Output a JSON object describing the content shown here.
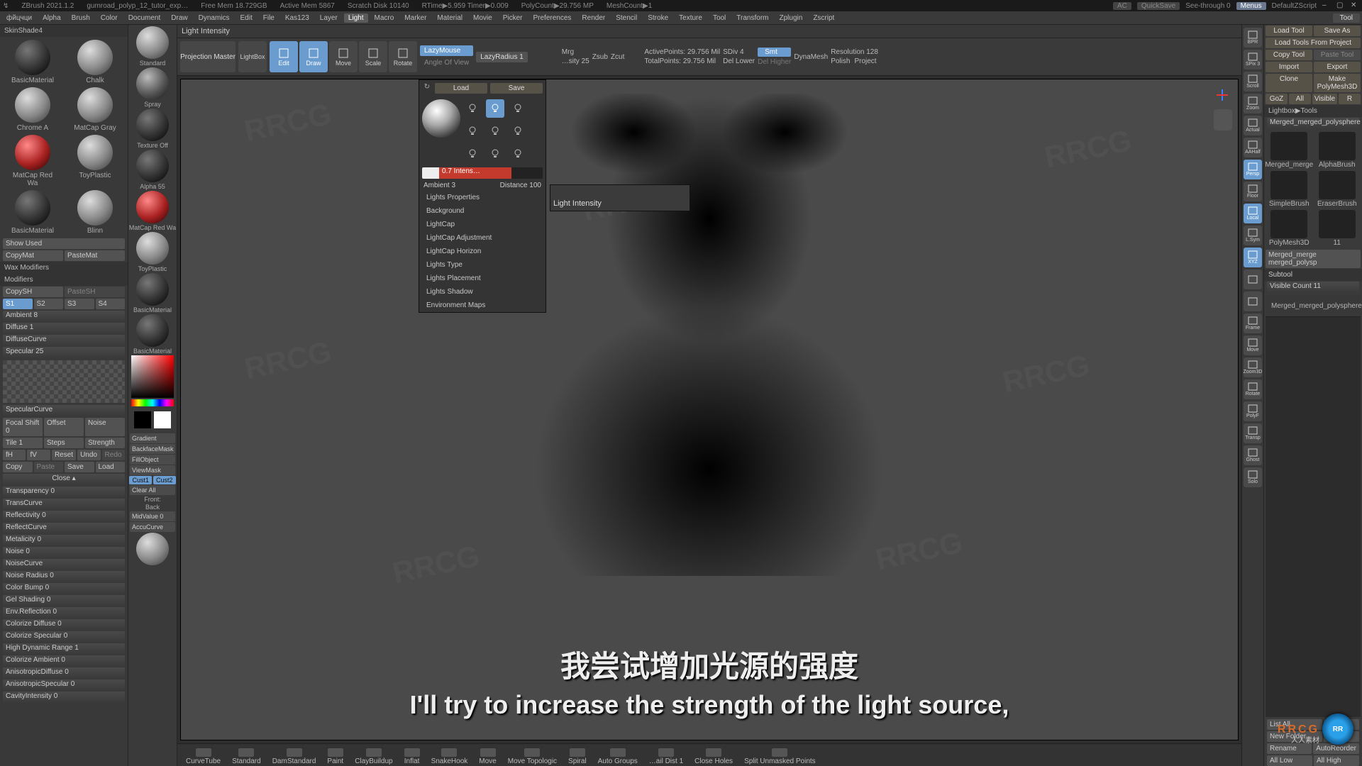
{
  "title": {
    "app": "ZBrush 2021.1.2",
    "doc": "gumroad_polyp_12_tutor_exp…",
    "mem": "Free Mem 18.729GB",
    "amem": "Active Mem 5867",
    "scratch": "Scratch Disk 10140",
    "rtime": "RTime▶5.959  Timer▶0.009",
    "polycount": "PolyCount▶29.756 MP",
    "meshcount": "MeshCount▶1",
    "ac": "AC",
    "quicksave": "QuickSave",
    "see": "See-through  0",
    "menus": "Menus",
    "zscript": "DefaultZScript"
  },
  "menu": {
    "items": [
      "фйцчци",
      "Alpha",
      "Brush",
      "Color",
      "Document",
      "Draw",
      "Dynamics",
      "Edit",
      "File",
      "Kas123",
      "Layer",
      "Light",
      "Macro",
      "Marker",
      "Material",
      "Movie",
      "Picker",
      "Preferences",
      "Render",
      "Stencil",
      "Stroke",
      "Texture",
      "Tool",
      "Transform",
      "Zplugin",
      "Zscript"
    ],
    "active": "Light",
    "tool": "Tool"
  },
  "status": "Light Intensity",
  "leftMaterials": {
    "shade_hdr": "SkinShade4",
    "cells": [
      {
        "name": "BasicMaterial",
        "style": "dark"
      },
      {
        "name": "Chalk",
        "style": "gray"
      },
      {
        "name": "Chrome A",
        "style": "gray"
      },
      {
        "name": "MatCap Gray",
        "style": "gray"
      },
      {
        "name": "MatCap Red Wa",
        "style": "red"
      },
      {
        "name": "ToyPlastic",
        "style": "gray"
      },
      {
        "name": "BasicMaterial",
        "style": "dark"
      },
      {
        "name": "Blinn",
        "style": "gray"
      }
    ],
    "show_used": "Show Used",
    "copy": "CopyMat",
    "paste": "PasteMat",
    "wax": "Wax Modifiers",
    "mod": "Modifiers",
    "copysh": "CopySH",
    "pastesh": "PasteSH",
    "s": [
      "S1",
      "S2",
      "S3",
      "S4"
    ],
    "sliders": [
      "Ambient 8",
      "Diffuse 1",
      "DiffuseCurve",
      "Specular 25"
    ],
    "speccurve": "SpecularCurve",
    "fs": "Focal Shift 0",
    "off": "Offset",
    "noise": "Noise",
    "tile": "Tile 1",
    "steps": "Steps",
    "strength": "Strength",
    "fh": "fH",
    "fv": "fV",
    "reset": "Reset",
    "undo": "Undo",
    "redo": "Redo",
    "copy2": "Copy",
    "paste2": "Paste",
    "save": "Save",
    "load": "Load",
    "close": "Close ▴",
    "extras": [
      "Transparency 0",
      "TransCurve",
      "Reflectivity 0",
      "ReflectCurve",
      "Metalicity 0",
      "Noise 0",
      "NoiseCurve",
      "Noise Radius 0",
      "Color Bump 0",
      "Gel Shading 0",
      "Env.Reflection 0",
      "Colorize Diffuse 0",
      "Colorize Specular 0",
      "High Dynamic Range 1",
      "Colorize Ambient 0",
      "AnisotropicDiffuse 0",
      "AnisotropicSpecular 0",
      "CavityIntensity 0"
    ]
  },
  "col2": {
    "items": [
      {
        "lbl": "Standard",
        "style": "gray"
      },
      {
        "lbl": "Spray",
        "style": ""
      },
      {
        "lbl": "Texture Off",
        "style": "dark"
      },
      {
        "lbl": "Alpha 55",
        "style": "dark"
      },
      {
        "lbl": "MatCap Red Wa",
        "style": "red"
      },
      {
        "lbl": "ToyPlastic",
        "style": "gray"
      },
      {
        "lbl": "BasicMaterial",
        "style": "dark"
      },
      {
        "lbl": "BasicMaterial",
        "style": "dark"
      }
    ],
    "grad": "Gradient",
    "bfm": "BackfaceMask",
    "fo": "FillObject",
    "vm": "ViewMask",
    "cust1": "Cust1",
    "cust2": "Cust2",
    "clr": "Clear All",
    "front": "Front:",
    "back": "Back",
    "mid": "MidValue 0",
    "accu": "AccuCurve"
  },
  "top": {
    "pm": "Projection Master",
    "lightbox": "LightBox",
    "modes": [
      {
        "l": "Edit",
        "hl": true
      },
      {
        "l": "Draw",
        "hl": true
      },
      {
        "l": "Move",
        "hl": false
      },
      {
        "l": "Scale",
        "hl": false
      },
      {
        "l": "Rotate",
        "hl": false
      }
    ],
    "lazy": "LazyMouse",
    "lazyr": "LazyRadius 1",
    "angle": "Angle Of View",
    "mrg": "Mrg",
    "zsub": "Zsub",
    "zcut": "Zcut",
    "sity": "…sity 25",
    "active": "ActivePoints: 29.756 Mil",
    "total": "TotalPoints: 29.756 Mil",
    "sdiv": "SDiv 4",
    "del_lower": "Del Lower",
    "del_higher": "Del Higher",
    "smt": "Smt",
    "dynamesh": "DynaMesh",
    "res": "Resolution 128",
    "polish": "Polish",
    "project": "Project"
  },
  "light": {
    "load": "Load",
    "save": "Save",
    "refresh": "↻",
    "intensity": "0.7  Intens…",
    "ambient": "Ambient 3",
    "distance": "Distance 100",
    "sections": [
      "Lights Properties",
      "Background",
      "LightCap",
      "LightCap Adjustment",
      "LightCap Horizon",
      "Lights Type",
      "Lights Placement",
      "Lights Shadow",
      "Environment Maps"
    ],
    "tooltip": "Light Intensity"
  },
  "rstrip": [
    "BPR",
    "SPix 3",
    "Scroll",
    "Zoom",
    "Actual",
    "AAHalf",
    "Persp",
    "Floor",
    "Local",
    "L.Sym",
    "XYZ",
    "",
    "",
    "Frame",
    "Move",
    "Zoom3D",
    "Rotate",
    "PolyF",
    "Transp",
    "Ghost",
    "Solo"
  ],
  "rpanel": {
    "rows": [
      [
        "Load Tool",
        "Save As"
      ],
      [
        "Load Tools From Project",
        ""
      ],
      [
        "Copy Tool",
        "Paste Tool"
      ],
      [
        "Import",
        "Export"
      ],
      [
        "Clone",
        "Make PolyMesh3D"
      ],
      [
        "GoZ",
        "All",
        "Visible",
        "R"
      ]
    ],
    "lb": "Lightbox▶Tools",
    "current": "Merged_merged_polysphere",
    "tools": [
      {
        "n": "Merged_merge"
      },
      {
        "n": "AlphaBrush"
      },
      {
        "n": "SimpleBrush"
      },
      {
        "n": "EraserBrush"
      },
      {
        "n": "PolyMesh3D"
      }
    ],
    "count": "11",
    "long": "Merged_merge merged_polysp",
    "sub_hdr": "Subtool",
    "visible": "Visible Count 11",
    "subitem": "Merged_merged_polysphere",
    "listall": "List All",
    "newfolder": "New Folder",
    "rename": "Rename",
    "autoreorder": "AutoReorder",
    "all_low": "All Low",
    "all_high": "All High"
  },
  "bottom": [
    "CurveTube",
    "Standard",
    "DamStandard",
    "Paint",
    "ClayBuildup",
    "Inflat",
    "SnakeHook",
    "Move",
    "Move Topologic",
    "Spiral",
    "Auto Groups",
    "…ail Dist 1",
    "Close Holes",
    "Split Unmasked Points"
  ],
  "subs": {
    "cn": "我尝试增加光源的强度",
    "en": "I'll try to increase the strength of the light source,"
  },
  "brand": {
    "logo": "RR",
    "name": "RRCG",
    "sub": "人人素材"
  }
}
